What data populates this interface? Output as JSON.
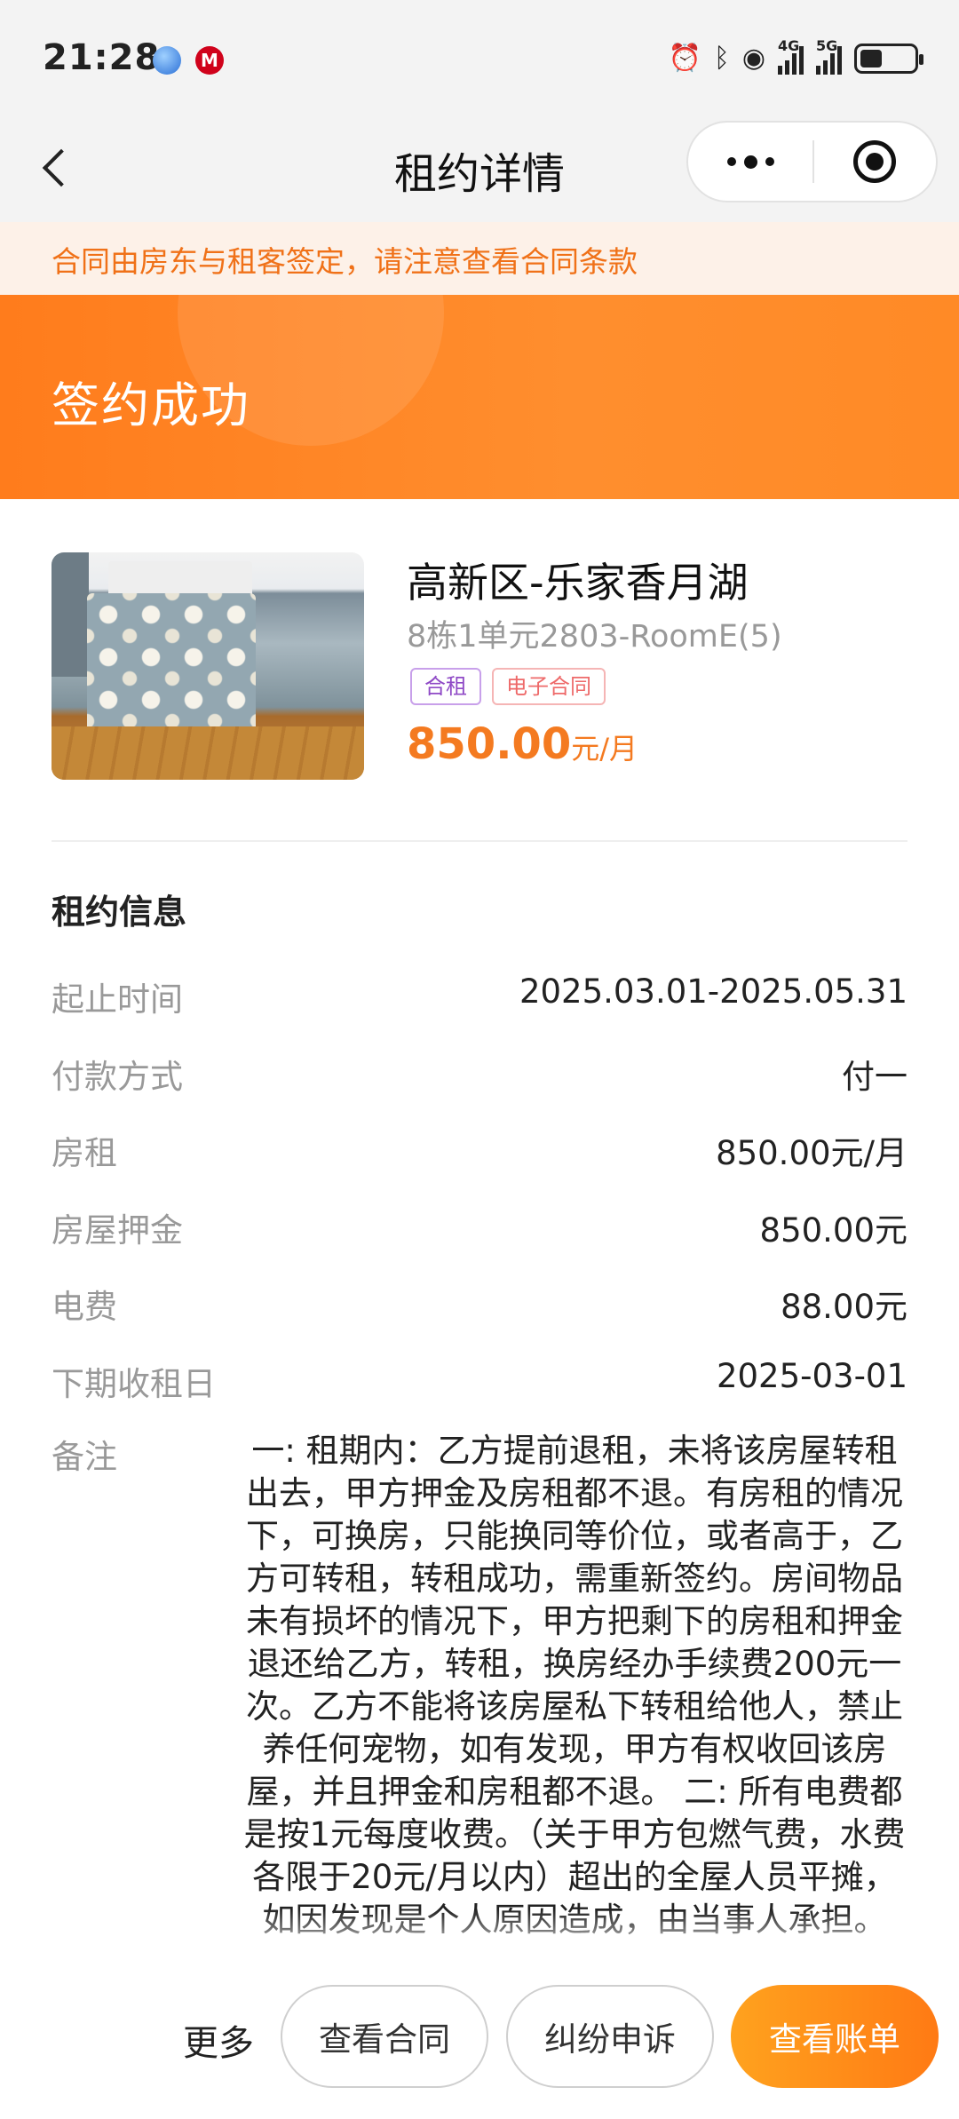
{
  "status_bar": {
    "time": "21:28",
    "network_1": "4G",
    "network_2": "5G",
    "app_badge": "M"
  },
  "nav": {
    "title": "租约详情"
  },
  "notice": {
    "text": "合同由房东与租客签定，请注意查看合同条款"
  },
  "banner": {
    "status": "签约成功"
  },
  "house": {
    "name": "高新区-乐家香月湖",
    "room": "8栋1单元2803-RoomE(5)",
    "tags": [
      "合租",
      "电子合同"
    ],
    "price": "850.00",
    "price_unit": "元/月"
  },
  "lease_info": {
    "title": "租约信息",
    "rows": [
      {
        "label": "起止时间",
        "value": "2025.03.01-2025.05.31"
      },
      {
        "label": "付款方式",
        "value": "付一"
      },
      {
        "label": "房租",
        "value": "850.00元/月"
      },
      {
        "label": "房屋押金",
        "value": "850.00元"
      },
      {
        "label": "电费",
        "value": "88.00元"
      },
      {
        "label": "下期收租日",
        "value": "2025-03-01"
      }
    ],
    "note_label": "备注",
    "note_text": "一: 租期内：乙方提前退租，未将该房屋转租出去，甲方押金及房租都不退。有房租的情况下，可换房，只能换同等价位，或者高于，乙方可转租，转租成功，需重新签约。房间物品未有损坏的情况下，甲方把剩下的房租和押金退还给乙方，转租，换房经办手续费200元一次。乙方不能将该房屋私下转租给他人，禁止养任何宠物，如有发现，甲方有权收回该房屋，并且押金和房租都不退。 二: 所有电费都是按1元每度收费。（关于甲方包燃气费，水费各限于20元/月以内）超出的全屋人员平摊，如因发现是个人原因造成，由当事人承担。"
  },
  "bottom_bar": {
    "more": "更多",
    "view_contract": "查看合同",
    "dispute": "纠纷申诉",
    "view_bill": "查看账单"
  },
  "colors": {
    "accent": "#ff7c1c",
    "price": "#f47a20",
    "notice_bg": "#fdf1e8"
  }
}
